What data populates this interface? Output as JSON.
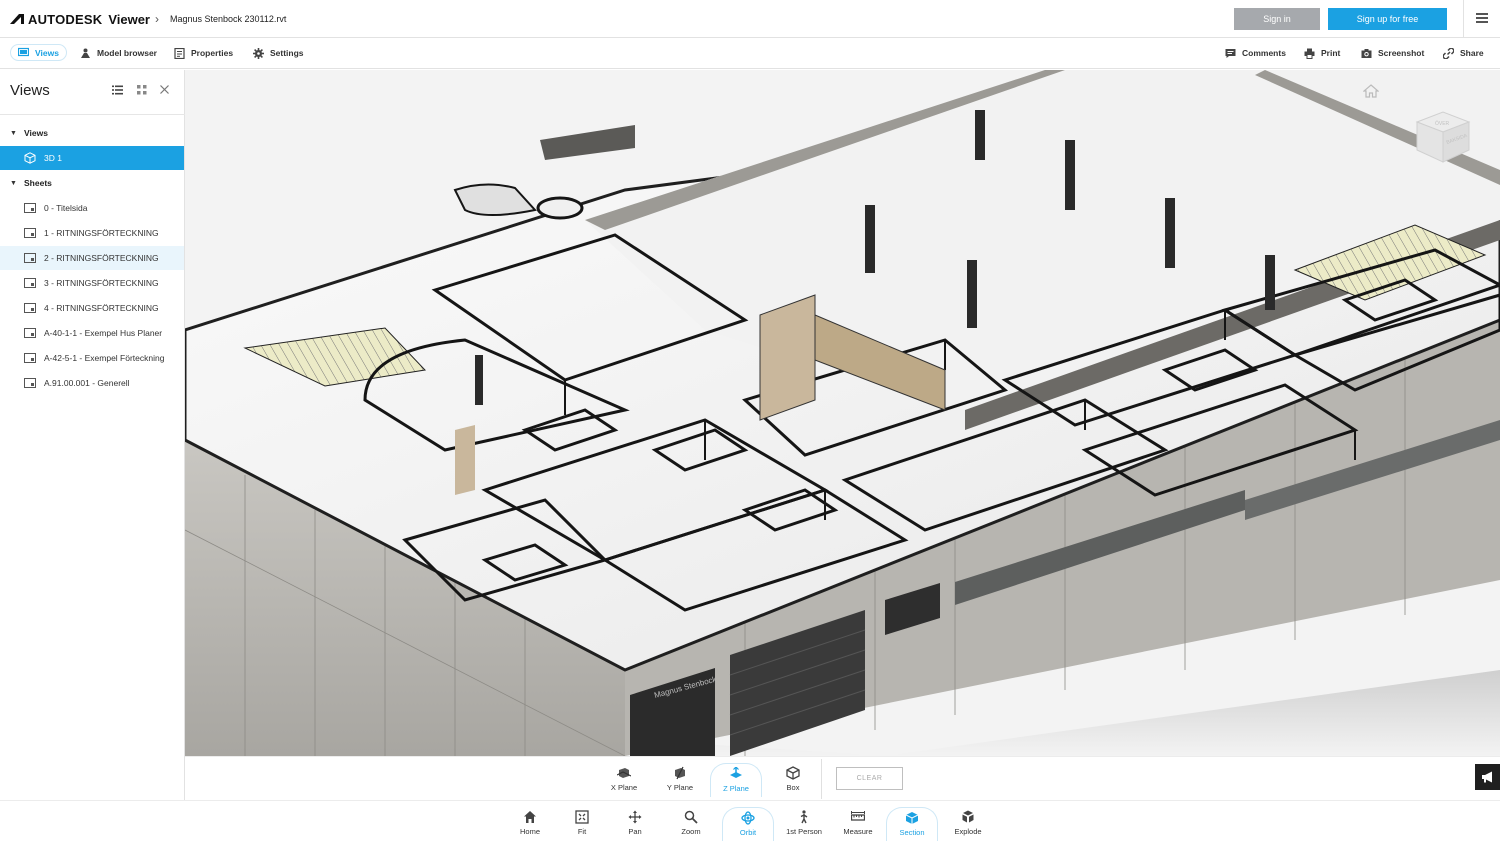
{
  "header": {
    "brand": "AUTODESK",
    "brand_sub": "Viewer",
    "filename": "Magnus Stenbock 230112.rvt",
    "sign_in": "Sign in",
    "sign_up": "Sign up for free"
  },
  "toolbar": {
    "views": "Views",
    "model_browser": "Model browser",
    "properties": "Properties",
    "settings": "Settings",
    "comments": "Comments",
    "print": "Print",
    "screenshot": "Screenshot",
    "share": "Share"
  },
  "panel": {
    "title": "Views",
    "groups": [
      {
        "label": "Views",
        "items": [
          "3D 1"
        ]
      },
      {
        "label": "Sheets",
        "items": [
          "0 - Titelsida",
          "1 - RITNINGSFÖRTECKNING",
          "2 - RITNINGSFÖRTECKNING",
          "3 - RITNINGSFÖRTECKNING",
          "4 - RITNINGSFÖRTECKNING",
          "A-40-1-1 - Exempel Hus Planer",
          "A-42-5-1 - Exempel Förteckning",
          "A.91.00.001 - Generell"
        ]
      }
    ],
    "selected": "3D 1"
  },
  "section_tools": {
    "x_plane": "X Plane",
    "y_plane": "Y Plane",
    "z_plane": "Z Plane",
    "box": "Box",
    "clear": "CLEAR",
    "active": "Z Plane"
  },
  "nav_tools": {
    "home": "Home",
    "fit": "Fit",
    "pan": "Pan",
    "zoom": "Zoom",
    "orbit": "Orbit",
    "first_person": "1st Person",
    "measure": "Measure",
    "section": "Section",
    "explode": "Explode",
    "active": [
      "Orbit",
      "Section"
    ]
  },
  "viewcube": {
    "face_top": "ÖVER",
    "face_side": "BAKSIDA"
  },
  "model_sign": "Magnus Stenbock",
  "colors": {
    "accent": "#1ba1e2",
    "sign_in_bg": "#a6a9ad",
    "hatch": "#e9e7b8"
  }
}
